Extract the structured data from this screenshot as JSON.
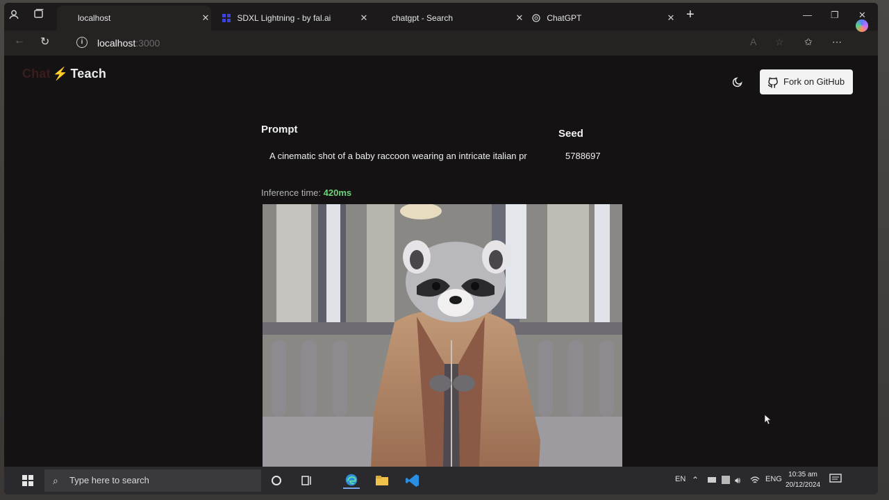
{
  "browser": {
    "tabs": [
      {
        "label": "localhost"
      },
      {
        "label": "SDXL Lightning - by fal.ai"
      },
      {
        "label": "chatgpt - Search"
      },
      {
        "label": "ChatGPT"
      }
    ],
    "url_host": "localhost",
    "url_port": ":3000"
  },
  "app": {
    "brand_prefix": "Chat",
    "brand_suffix": "Teach",
    "github_button": "Fork on GitHub"
  },
  "form": {
    "prompt_label": "Prompt",
    "prompt_value": "A cinematic shot of a baby raccoon wearing an intricate italian pr",
    "seed_label": "Seed",
    "seed_value": "5788697"
  },
  "result": {
    "inference_label": "Inference time:",
    "inference_value": "420ms"
  },
  "taskbar": {
    "search_placeholder": "Type here to search",
    "lang_short": "EN",
    "lang_long": "ENG",
    "time": "10:35 am",
    "date": "20/12/2024"
  },
  "colors": {
    "inference_accent": "#6fd37a",
    "brand_bolt": "#f2c94c",
    "page_bg": "#141212"
  }
}
